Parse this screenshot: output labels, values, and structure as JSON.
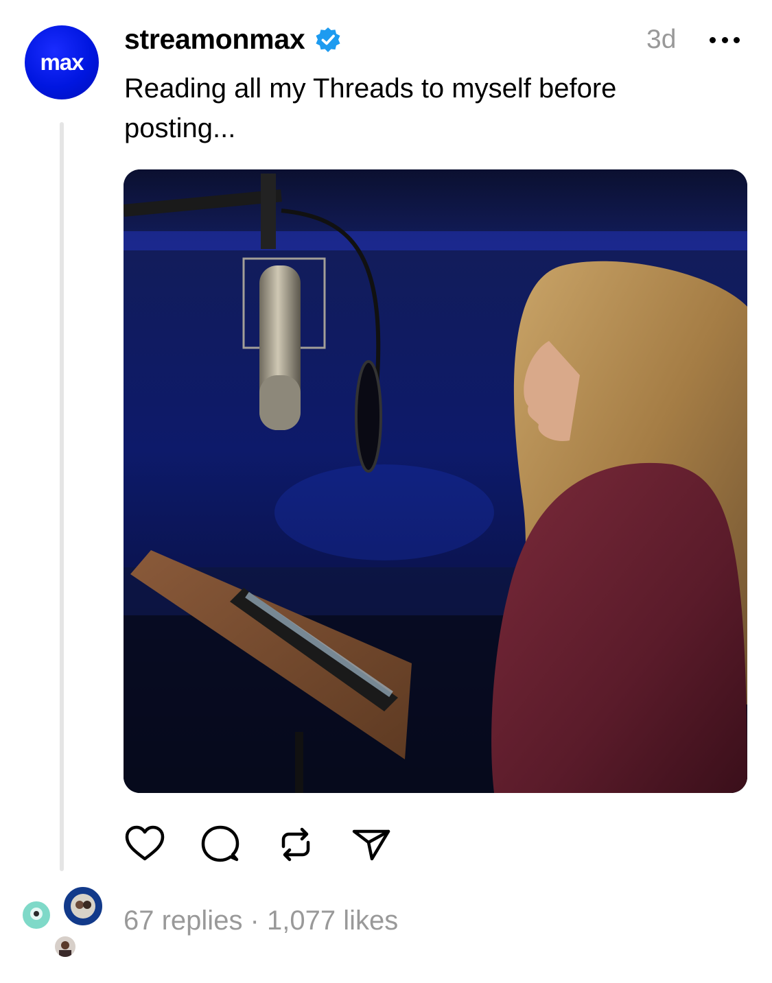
{
  "post": {
    "avatar_text": "max",
    "username": "streamonmax",
    "verified": true,
    "timestamp": "3d",
    "text": "Reading all my Threads to myself before posting...",
    "more_icon": "ellipsis-icon"
  },
  "actions": {
    "like_icon": "heart-icon",
    "reply_icon": "comment-icon",
    "repost_icon": "repost-icon",
    "share_icon": "send-icon"
  },
  "stats": {
    "replies": "67 replies",
    "separator": " · ",
    "likes": "1,077 likes"
  },
  "colors": {
    "brand_blue": "#0016e0",
    "verified_blue": "#1d9bf0",
    "muted_text": "#999999"
  }
}
